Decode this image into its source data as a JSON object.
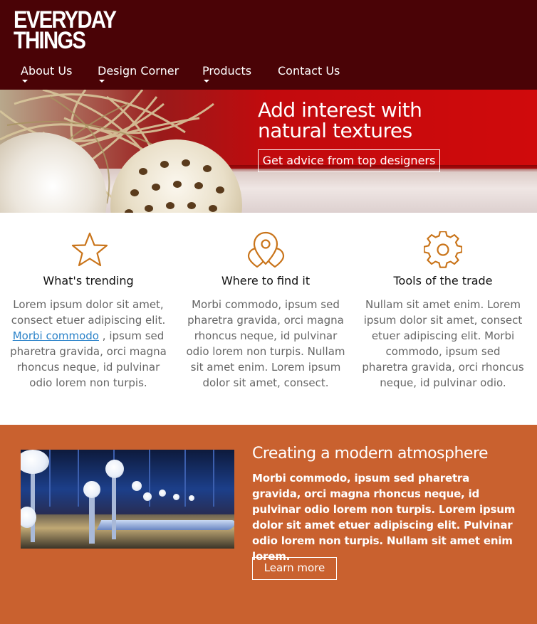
{
  "header": {
    "logo_line1": "EVERYDAY",
    "logo_line2": "THINGS",
    "nav": [
      {
        "label": "About Us",
        "has_dropdown": true
      },
      {
        "label": "Design Corner",
        "has_dropdown": true
      },
      {
        "label": "Products",
        "has_dropdown": true
      },
      {
        "label": "Contact Us",
        "has_dropdown": false
      }
    ]
  },
  "hero": {
    "title_line1": "Add interest with",
    "title_line2": "natural textures",
    "button_label": "Get advice from top designers"
  },
  "features": [
    {
      "icon": "star-icon",
      "title": "What's trending",
      "text_before_link": "Lorem ipsum dolor sit amet, consect etuer adipiscing elit.",
      "link_text": "Morbi commodo",
      "text_after_link": ", ipsum sed pharetra gravida, orci magna rhoncus neque, id pulvinar odio lorem non turpis."
    },
    {
      "icon": "map-pin-icon",
      "title": "Where to find it",
      "text": "Morbi commodo, ipsum sed pharetra gravida, orci magna rhoncus neque, id pulvinar odio lorem non turpis. Nullam sit amet enim. Lorem ipsum dolor sit amet, consect."
    },
    {
      "icon": "gear-icon",
      "title": "Tools of the trade",
      "text": "Nullam sit amet enim. Lorem ipsum dolor sit amet, consect etuer adipiscing elit. Morbi commodo, ipsum sed pharetra gravida, orci rhoncus neque, id pulvinar odio."
    }
  ],
  "promo": {
    "title": "Creating a modern atmosphere",
    "text": "Morbi commodo, ipsum sed pharetra gravida, orci magna rhoncus neque, id pulvinar odio lorem non turpis. Lorem ipsum dolor sit amet etuer adipiscing elit. Pulvinar odio lorem non turpis. Nullam sit amet enim lorem.",
    "button_label": "Learn more"
  },
  "colors": {
    "header_bg": "#4a0306",
    "accent_icon": "#c9741a",
    "promo_bg": "#c9612f",
    "link": "#2a82c9"
  }
}
